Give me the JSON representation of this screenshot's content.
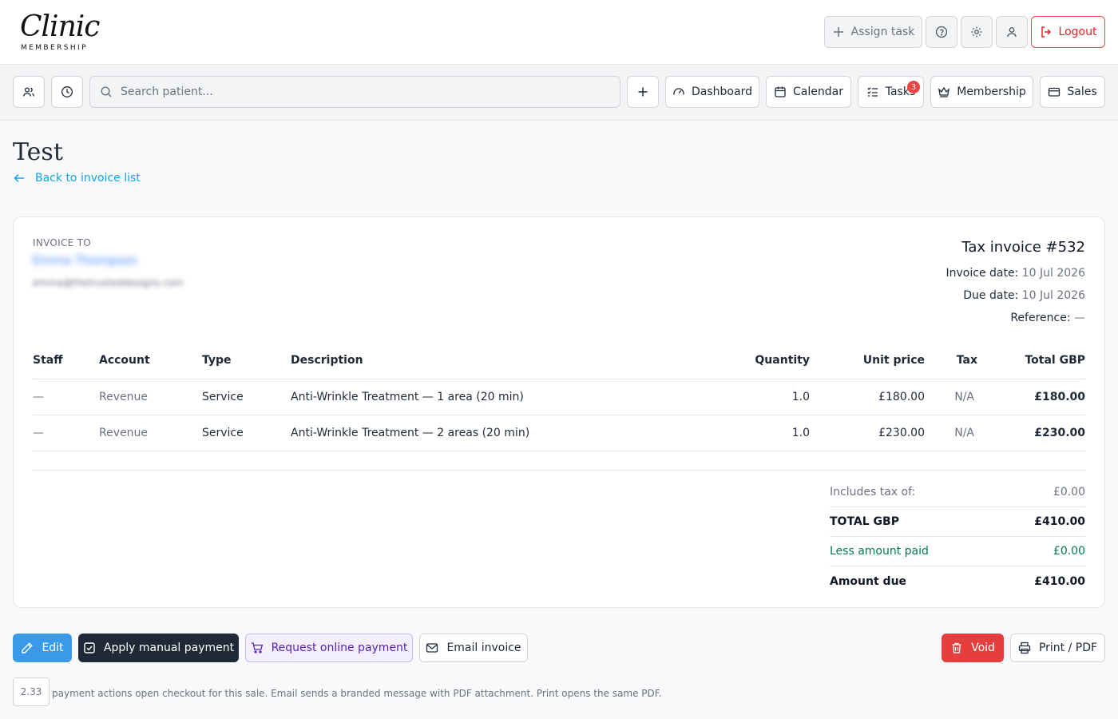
{
  "logo": {
    "script": "Clinic",
    "sub": "MEMBERSHIP"
  },
  "header": {
    "assign_task": "Assign task",
    "logout": "Logout"
  },
  "nav": {
    "search_placeholder": "Search patient...",
    "dashboard": "Dashboard",
    "calendar": "Calendar",
    "tasks": "Tasks",
    "tasks_badge": "3",
    "membership": "Membership",
    "sales": "Sales"
  },
  "page": {
    "title": "Test",
    "back": "Back to invoice list"
  },
  "invoice": {
    "to_label": "INVOICE TO",
    "client_name": "Emma Thompson",
    "client_email": "emma@thetrusteddesigns.com",
    "title": "Tax invoice #532",
    "invoice_date_label": "Invoice date:",
    "invoice_date": "10 Jul 2026",
    "due_date_label": "Due date:",
    "due_date": "10 Jul 2026",
    "reference_label": "Reference:",
    "reference": "—",
    "columns": [
      "Staff",
      "Account",
      "Type",
      "Description",
      "Quantity",
      "Unit price",
      "Tax",
      "Total GBP"
    ],
    "rows": [
      {
        "staff": "—",
        "account": "Revenue",
        "type": "Service",
        "description": "Anti-Wrinkle Treatment — 1 area (20 min)",
        "quantity": "1.0",
        "unit_price": "£180.00",
        "tax": "N/A",
        "total": "£180.00"
      },
      {
        "staff": "—",
        "account": "Revenue",
        "type": "Service",
        "description": "Anti-Wrinkle Treatment — 2 areas (20 min)",
        "quantity": "1.0",
        "unit_price": "£230.00",
        "tax": "N/A",
        "total": "£230.00"
      }
    ],
    "totals": {
      "tax_label": "Includes tax of:",
      "tax": "£0.00",
      "total_label": "TOTAL GBP",
      "total": "£410.00",
      "paid_label": "Less amount paid",
      "paid": "£0.00",
      "due_label": "Amount due",
      "due": "£410.00"
    }
  },
  "actions": {
    "edit": "Edit",
    "manual": "Apply manual payment",
    "online": "Request online payment",
    "email": "Email invoice",
    "void": "Void",
    "print": "Print / PDF"
  },
  "footer": {
    "version": "2.33",
    "note": "payment actions open checkout for this sale. Email sends a branded message with PDF attachment. Print opens the same PDF."
  },
  "colors": {
    "accent": "#3b9ae8",
    "danger": "#e53e3e",
    "link": "#0ea5e9",
    "paid_green": "#047857"
  }
}
